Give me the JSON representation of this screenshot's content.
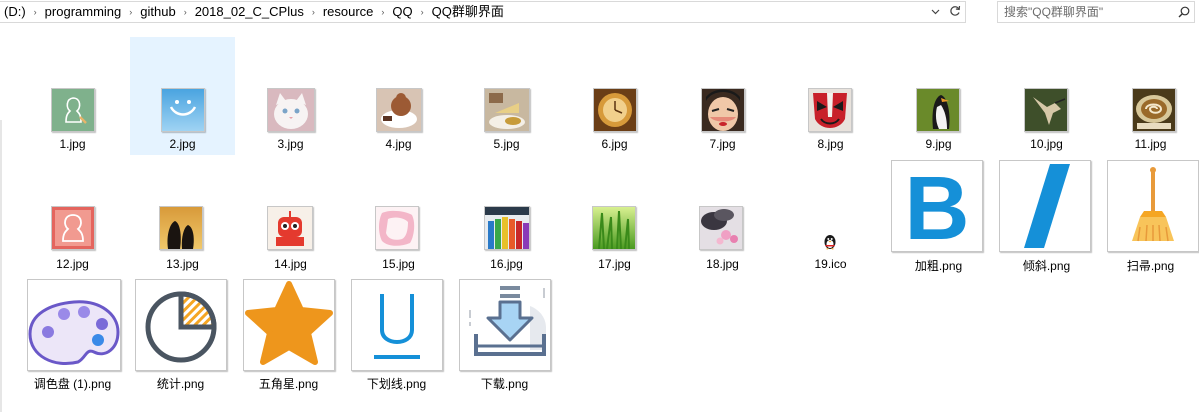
{
  "breadcrumbs": [
    "(D:)",
    "programming",
    "github",
    "2018_02_C_CPlus",
    "resource",
    "QQ",
    "QQ群聊界面"
  ],
  "search": {
    "placeholder": "搜索\"QQ群聊界面\""
  },
  "files": [
    {
      "name": "1.jpg",
      "icon": "contact-silhouette-icon"
    },
    {
      "name": "2.jpg",
      "icon": "sky-smile-icon",
      "selected": true
    },
    {
      "name": "3.jpg",
      "icon": "white-cat-icon"
    },
    {
      "name": "4.jpg",
      "icon": "gingerbread-coffee-icon"
    },
    {
      "name": "5.jpg",
      "icon": "cake-tea-icon"
    },
    {
      "name": "6.jpg",
      "icon": "pocket-watch-icon"
    },
    {
      "name": "7.jpg",
      "icon": "opera-face-icon"
    },
    {
      "name": "8.jpg",
      "icon": "opera-mask-icon"
    },
    {
      "name": "9.jpg",
      "icon": "penguin-photo-icon"
    },
    {
      "name": "10.jpg",
      "icon": "hummingbird-icon"
    },
    {
      "name": "11.jpg",
      "icon": "latte-art-icon"
    },
    {
      "name": "12.jpg",
      "icon": "red-contact-silhouette-icon"
    },
    {
      "name": "13.jpg",
      "icon": "penguins-sunset-icon"
    },
    {
      "name": "14.jpg",
      "icon": "red-robot-icon"
    },
    {
      "name": "15.jpg",
      "icon": "pink-frame-icon"
    },
    {
      "name": "16.jpg",
      "icon": "colored-pencils-icon"
    },
    {
      "name": "17.jpg",
      "icon": "green-grass-icon"
    },
    {
      "name": "18.jpg",
      "icon": "flower-stones-icon"
    },
    {
      "name": "19.ico",
      "icon": "qq-penguin-icon"
    },
    {
      "name": "加粗.png",
      "icon": "bold-icon"
    },
    {
      "name": "倾斜.png",
      "icon": "italic-icon"
    },
    {
      "name": "扫帚.png",
      "icon": "broom-icon"
    },
    {
      "name": "调色盘 (1).png",
      "icon": "palette-icon"
    },
    {
      "name": "统计.png",
      "icon": "pie-chart-icon"
    },
    {
      "name": "五角星.png",
      "icon": "star-icon"
    },
    {
      "name": "下划线.png",
      "icon": "underline-icon"
    },
    {
      "name": "下载.png",
      "icon": "download-icon"
    }
  ],
  "colors": {
    "selection": "#e5f3ff",
    "bold_blue": "#1590d8",
    "star_orange": "#ee961c"
  }
}
